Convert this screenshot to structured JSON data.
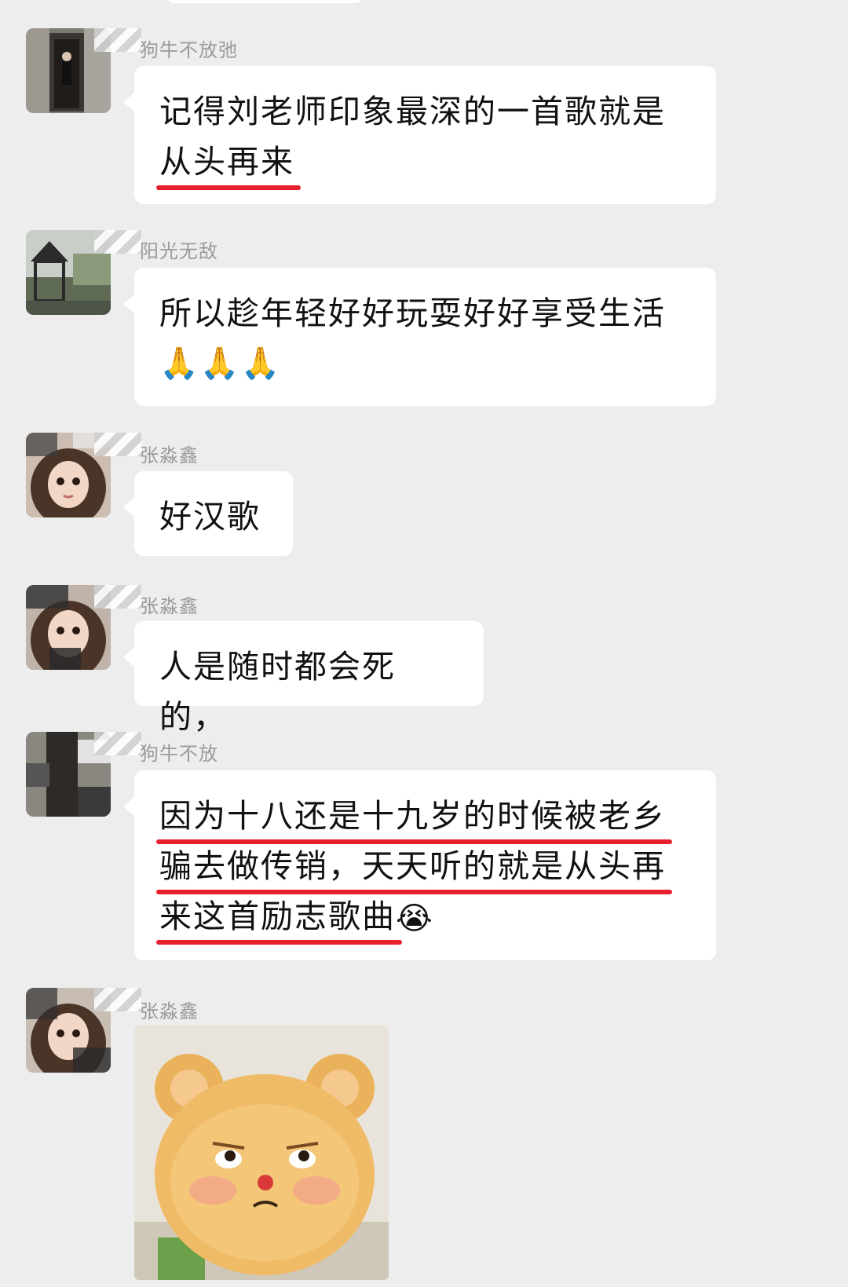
{
  "messages": [
    {
      "sender": "狗牛不放弛",
      "line1": "记得刘老师印象最深的一首歌就是",
      "line2": "从头再来"
    },
    {
      "sender": "阳光无敌",
      "line1": "所以趁年轻好好玩耍好好享受生活",
      "emoji": "🙏🙏🙏"
    },
    {
      "sender": "张淼鑫",
      "line1": "好汉歌"
    },
    {
      "sender": "张淼鑫",
      "line1": "人是随时都会死的，"
    },
    {
      "sender": "狗牛不放",
      "line1": "因为十八还是十九岁的时候被老乡",
      "line2": "骗去做传销，天天听的就是从头再",
      "line3": "来这首励志歌曲",
      "emoji": "😭"
    },
    {
      "sender": "张淼鑫",
      "sticker": "teddy-bear-sticker"
    }
  ]
}
